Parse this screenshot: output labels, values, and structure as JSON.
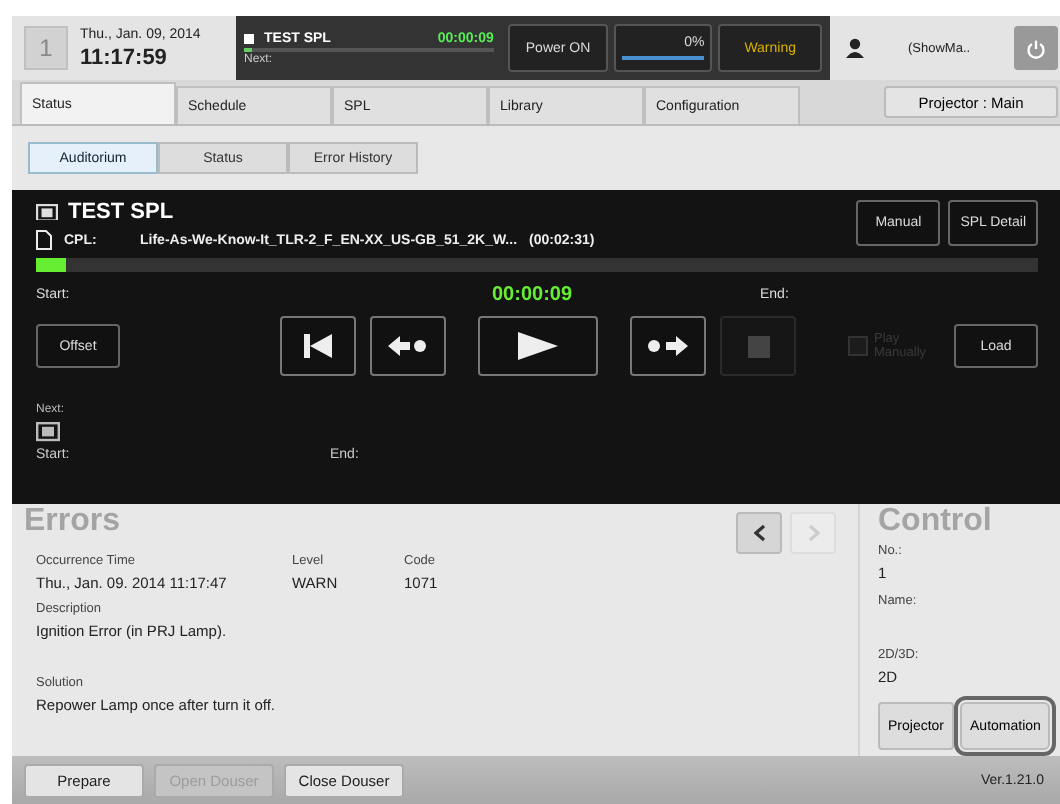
{
  "header": {
    "screen_number": "1",
    "date": "Thu., Jan. 09, 2014",
    "time": "11:17:59"
  },
  "now_playing": {
    "title": "TEST SPL",
    "timecode": "00:00:09",
    "next_label": "Next:",
    "level": 0.03
  },
  "power_button": "Power ON",
  "meter": {
    "reading": "0%"
  },
  "warning_button": "Warning",
  "user": "(ShowMa..",
  "tabs": [
    {
      "label": "Status",
      "selected": true
    },
    {
      "label": "Schedule",
      "selected": false
    },
    {
      "label": "SPL",
      "selected": false
    },
    {
      "label": "Library",
      "selected": false
    },
    {
      "label": "Configuration",
      "selected": false
    }
  ],
  "projector_button": "Projector : Main",
  "subtabs": [
    {
      "label": "Auditorium",
      "selected": true
    },
    {
      "label": "Status",
      "selected": false
    },
    {
      "label": "Error History",
      "selected": false
    }
  ],
  "player": {
    "title": "TEST SPL",
    "cpl_label": "CPL:",
    "cpl_name": "Life-As-We-Know-It_TLR-2_F_EN-XX_US-GB_51_2K_W...",
    "cpl_duration": "(00:02:31)",
    "buttons": [
      "Manual",
      "SPL Detail"
    ],
    "progress": {
      "level": 0.03
    },
    "start_label": "Start:",
    "timecode": "00:00:09",
    "end_label": "End:",
    "offset_button": "Offset",
    "transport": [
      {
        "kind": "rewind",
        "disabled": false
      },
      {
        "kind": "back",
        "disabled": false
      },
      {
        "kind": "play",
        "disabled": false
      },
      {
        "kind": "forward",
        "disabled": false
      },
      {
        "kind": "stop",
        "disabled": true
      }
    ],
    "play_manually": {
      "label": "Play Manually",
      "checked": false,
      "disabled": true
    },
    "load_button": "Load",
    "next": {
      "label": "Next:",
      "start_label": "Start:",
      "end_label": "End:"
    }
  },
  "errors": {
    "title": "Errors",
    "prev_disabled": false,
    "next_disabled": true,
    "occurrence_time": {
      "label": "Occurrence Time",
      "value": "Thu., Jan. 09. 2014 11:17:47"
    },
    "level": {
      "label": "Level",
      "value": "WARN"
    },
    "code": {
      "label": "Code",
      "value": "1071"
    },
    "description": {
      "label": "Description",
      "value": "Ignition Error (in PRJ Lamp)."
    },
    "solution": {
      "label": "Solution",
      "value": "Repower Lamp once after turn it off."
    }
  },
  "control": {
    "title": "Control",
    "no": {
      "label": "No.:",
      "value": "1"
    },
    "name": {
      "label": "Name:"
    },
    "mode": {
      "label": "2D/3D:",
      "value": "2D"
    },
    "buttons": [
      {
        "label": "Projector",
        "selected": false
      },
      {
        "label": "Automation",
        "selected": true
      }
    ]
  },
  "footer": {
    "buttons": [
      {
        "label": "Prepare",
        "disabled": false
      },
      {
        "label": "Open Douser",
        "disabled": true
      },
      {
        "label": "Close Douser",
        "disabled": false
      }
    ],
    "version": "Ver.1.21.0"
  }
}
